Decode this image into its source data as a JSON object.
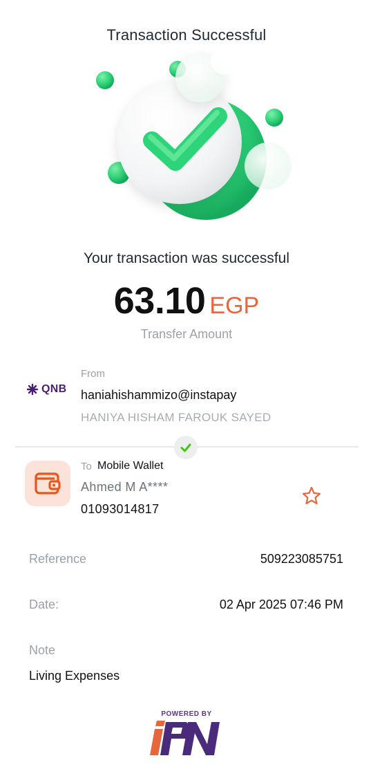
{
  "header": {
    "title": "Transaction Successful"
  },
  "status": {
    "message": "Your transaction was successful",
    "amount": "63.10",
    "currency": "EGP",
    "amount_label": "Transfer Amount"
  },
  "from": {
    "label": "From",
    "bank_logo": "QNB",
    "handle": "haniahishammizo@instapay",
    "name": "HANIYA HISHAM FAROUK SAYED"
  },
  "to": {
    "label": "To",
    "type": "Mobile Wallet",
    "name": "Ahmed M A****",
    "phone": "01093014817",
    "wallet_icon": "wallet-icon",
    "favorite_icon": "star-outline-icon"
  },
  "details": {
    "reference_label": "Reference",
    "reference_value": "509223085751",
    "date_label": "Date:",
    "date_value": "02 Apr 2025 07:46 PM",
    "note_label": "Note",
    "note_value": "Living Expenses"
  },
  "footer": {
    "powered_by": "POWERED BY",
    "brand_logo": "IPN"
  },
  "colors": {
    "accent": "#e8663d",
    "success": "#2ed47a",
    "muted": "#9aa1a8",
    "wallet_bg": "#fbe3d9"
  }
}
